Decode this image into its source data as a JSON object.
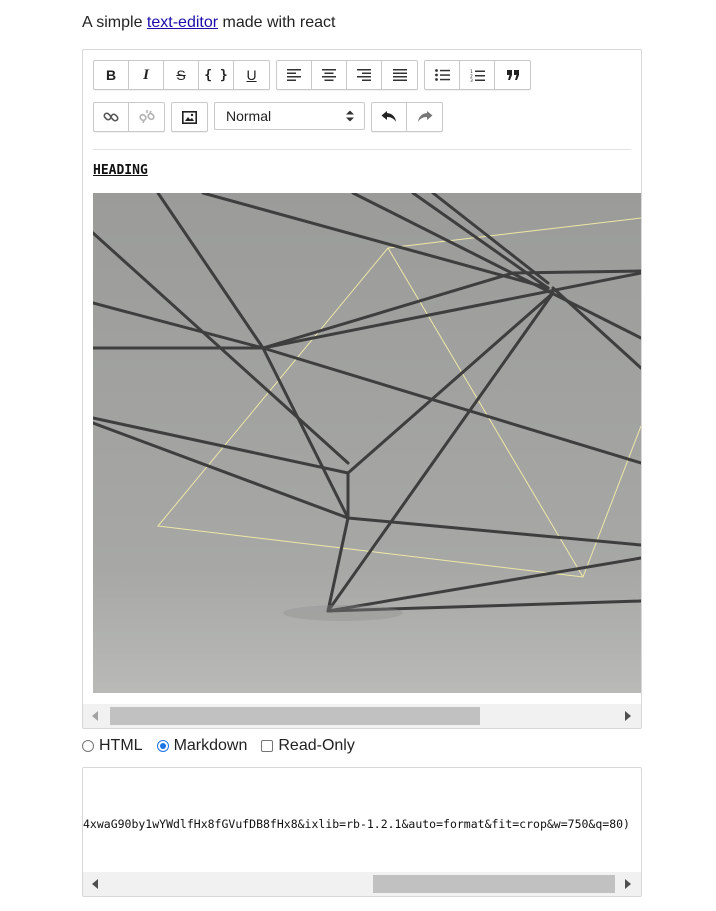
{
  "intro": {
    "prefix": "A simple ",
    "link": "text-editor",
    "suffix": " made with react"
  },
  "toolbar": {
    "inline_styles": [
      {
        "label": "B",
        "name": "bold-button"
      },
      {
        "label": "I",
        "name": "italic-button"
      },
      {
        "label": "S",
        "name": "strikethrough-button"
      },
      {
        "label": "{}",
        "name": "code-button"
      },
      {
        "label": "U",
        "name": "underline-button"
      }
    ],
    "alignment": [
      "align-left",
      "align-center",
      "align-right",
      "align-justify"
    ],
    "lists": [
      "unordered-list",
      "ordered-list",
      "blockquote"
    ],
    "block_type": "Normal"
  },
  "content": {
    "heading": "HEADING"
  },
  "format_options": {
    "html": "HTML",
    "markdown": "Markdown",
    "readonly": "Read-Only",
    "selected": "Markdown"
  },
  "output": {
    "text": "4xwaG90by1wYWdlfHx8fGVufDB8fHx8&ixlib=rb-1.2.1&auto=format&fit=crop&w=750&q=80)"
  },
  "colors": {
    "link": "#1a0dab",
    "radio_accent": "#1a73e8",
    "scroll_thumb": "#c1c1c1"
  }
}
